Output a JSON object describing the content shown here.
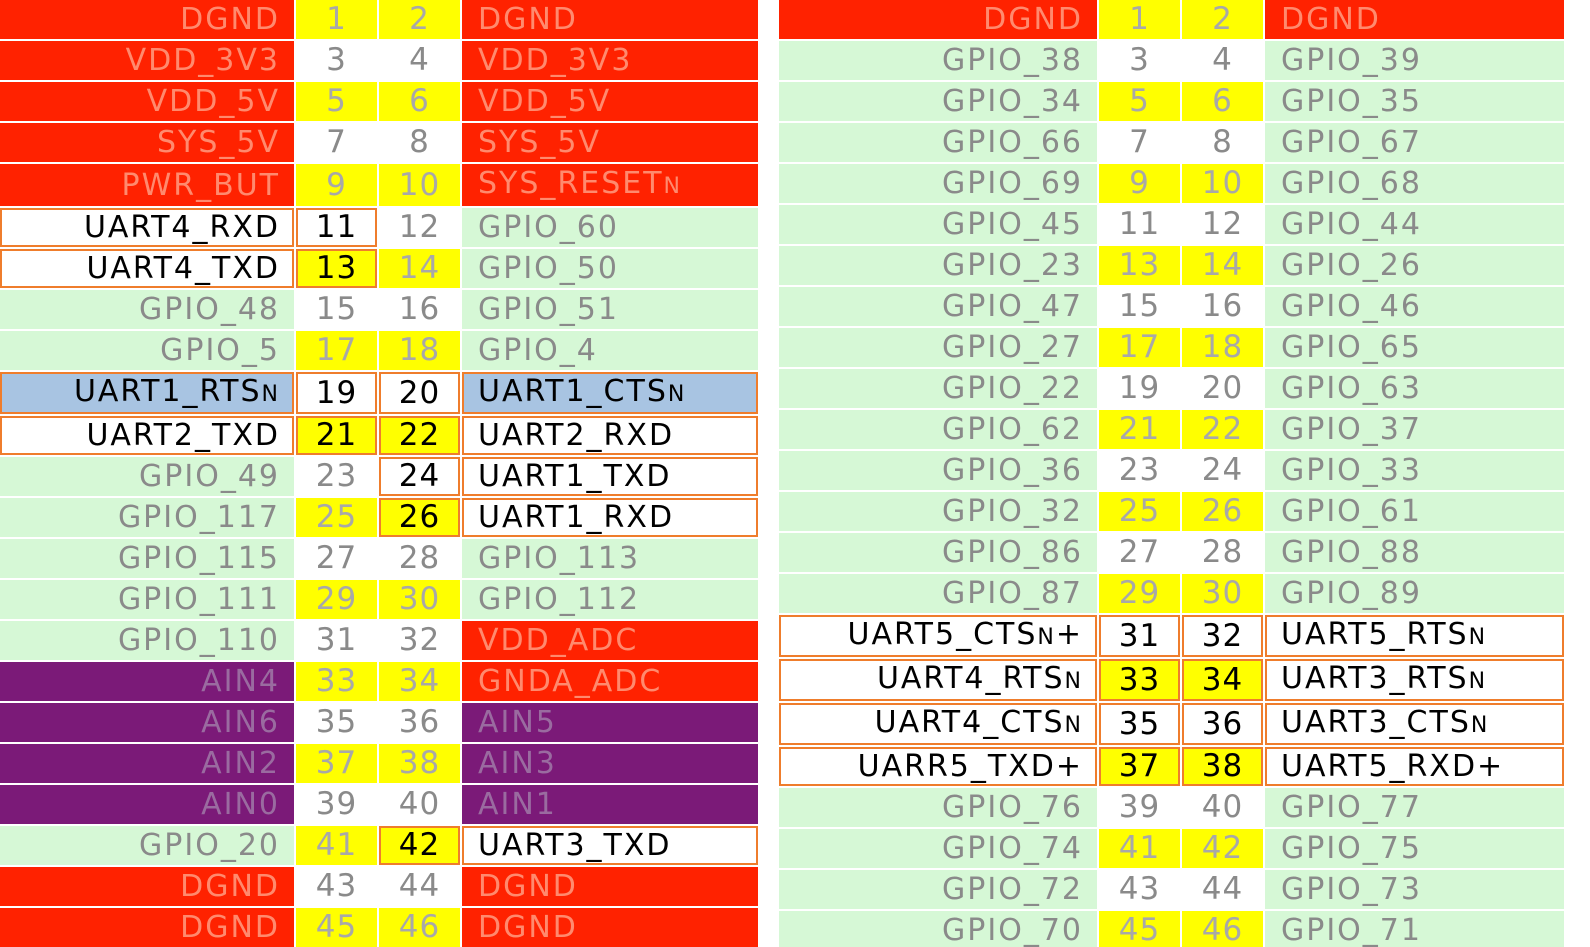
{
  "colors": {
    "power": "#ff2200",
    "gpio": "#d6f8d6",
    "analog": "#7b1a78",
    "uart_border": "#ef7d2c",
    "uart_highlight": "#a8c4e2",
    "pin_yellow": "#ffff00"
  },
  "headers": [
    {
      "id": "p8",
      "rows": [
        {
          "left": "DGND",
          "lpin": "1",
          "rpin": "2",
          "right": "DGND",
          "lt": "power",
          "rt": "power",
          "lpu": false,
          "rpu": false
        },
        {
          "left": "VDD_3V3",
          "lpin": "3",
          "rpin": "4",
          "right": "VDD_3V3",
          "lt": "power",
          "rt": "power",
          "lpu": false,
          "rpu": false
        },
        {
          "left": "VDD_5V",
          "lpin": "5",
          "rpin": "6",
          "right": "VDD_5V",
          "lt": "power",
          "rt": "power",
          "lpu": false,
          "rpu": false
        },
        {
          "left": "SYS_5V",
          "lpin": "7",
          "rpin": "8",
          "right": "SYS_5V",
          "lt": "power",
          "rt": "power",
          "lpu": false,
          "rpu": false
        },
        {
          "left": "PWR_BUT",
          "lpin": "9",
          "rpin": "10",
          "right": "SYS_RESETn",
          "lt": "power",
          "rt": "power",
          "lpu": false,
          "rpu": false
        },
        {
          "left": "UART4_RXD",
          "lpin": "11",
          "rpin": "12",
          "right": "GPIO_60",
          "lt": "uart",
          "rt": "gpio",
          "lpu": true,
          "rpu": false
        },
        {
          "left": "UART4_TXD",
          "lpin": "13",
          "rpin": "14",
          "right": "GPIO_50",
          "lt": "uart",
          "rt": "gpio",
          "lpu": true,
          "rpu": false
        },
        {
          "left": "GPIO_48",
          "lpin": "15",
          "rpin": "16",
          "right": "GPIO_51",
          "lt": "gpio",
          "rt": "gpio",
          "lpu": false,
          "rpu": false
        },
        {
          "left": "GPIO_5",
          "lpin": "17",
          "rpin": "18",
          "right": "GPIO_4",
          "lt": "gpio",
          "rt": "gpio",
          "lpu": false,
          "rpu": false
        },
        {
          "left": "UART1_RTSn",
          "lpin": "19",
          "rpin": "20",
          "right": "UART1_CTSn",
          "lt": "uart-hl",
          "rt": "uart-hl",
          "lpu": true,
          "rpu": true
        },
        {
          "left": "UART2_TXD",
          "lpin": "21",
          "rpin": "22",
          "right": "UART2_RXD",
          "lt": "uart",
          "rt": "uart",
          "lpu": true,
          "rpu": true
        },
        {
          "left": "GPIO_49",
          "lpin": "23",
          "rpin": "24",
          "right": "UART1_TXD",
          "lt": "gpio",
          "rt": "uart",
          "lpu": false,
          "rpu": true
        },
        {
          "left": "GPIO_117",
          "lpin": "25",
          "rpin": "26",
          "right": "UART1_RXD",
          "lt": "gpio",
          "rt": "uart",
          "lpu": false,
          "rpu": true
        },
        {
          "left": "GPIO_115",
          "lpin": "27",
          "rpin": "28",
          "right": "GPIO_113",
          "lt": "gpio",
          "rt": "gpio",
          "lpu": false,
          "rpu": false
        },
        {
          "left": "GPIO_111",
          "lpin": "29",
          "rpin": "30",
          "right": "GPIO_112",
          "lt": "gpio",
          "rt": "gpio",
          "lpu": false,
          "rpu": false
        },
        {
          "left": "GPIO_110",
          "lpin": "31",
          "rpin": "32",
          "right": "VDD_ADC",
          "lt": "gpio",
          "rt": "power",
          "lpu": false,
          "rpu": false
        },
        {
          "left": "AIN4",
          "lpin": "33",
          "rpin": "34",
          "right": "GNDA_ADC",
          "lt": "analog",
          "rt": "power",
          "lpu": false,
          "rpu": false
        },
        {
          "left": "AIN6",
          "lpin": "35",
          "rpin": "36",
          "right": "AIN5",
          "lt": "analog",
          "rt": "analog",
          "lpu": false,
          "rpu": false
        },
        {
          "left": "AIN2",
          "lpin": "37",
          "rpin": "38",
          "right": "AIN3",
          "lt": "analog",
          "rt": "analog",
          "lpu": false,
          "rpu": false
        },
        {
          "left": "AIN0",
          "lpin": "39",
          "rpin": "40",
          "right": "AIN1",
          "lt": "analog",
          "rt": "analog",
          "lpu": false,
          "rpu": false
        },
        {
          "left": "GPIO_20",
          "lpin": "41",
          "rpin": "42",
          "right": "UART3_TXD",
          "lt": "gpio",
          "rt": "uart",
          "lpu": false,
          "rpu": true
        },
        {
          "left": "DGND",
          "lpin": "43",
          "rpin": "44",
          "right": "DGND",
          "lt": "power",
          "rt": "power",
          "lpu": false,
          "rpu": false
        },
        {
          "left": "DGND",
          "lpin": "45",
          "rpin": "46",
          "right": "DGND",
          "lt": "power",
          "rt": "power",
          "lpu": false,
          "rpu": false
        }
      ]
    },
    {
      "id": "p9",
      "rows": [
        {
          "left": "DGND",
          "lpin": "1",
          "rpin": "2",
          "right": "DGND",
          "lt": "power",
          "rt": "power",
          "lpu": false,
          "rpu": false
        },
        {
          "left": "GPIO_38",
          "lpin": "3",
          "rpin": "4",
          "right": "GPIO_39",
          "lt": "gpio",
          "rt": "gpio",
          "lpu": false,
          "rpu": false
        },
        {
          "left": "GPIO_34",
          "lpin": "5",
          "rpin": "6",
          "right": "GPIO_35",
          "lt": "gpio",
          "rt": "gpio",
          "lpu": false,
          "rpu": false
        },
        {
          "left": "GPIO_66",
          "lpin": "7",
          "rpin": "8",
          "right": "GPIO_67",
          "lt": "gpio",
          "rt": "gpio",
          "lpu": false,
          "rpu": false
        },
        {
          "left": "GPIO_69",
          "lpin": "9",
          "rpin": "10",
          "right": "GPIO_68",
          "lt": "gpio",
          "rt": "gpio",
          "lpu": false,
          "rpu": false
        },
        {
          "left": "GPIO_45",
          "lpin": "11",
          "rpin": "12",
          "right": "GPIO_44",
          "lt": "gpio",
          "rt": "gpio",
          "lpu": false,
          "rpu": false
        },
        {
          "left": "GPIO_23",
          "lpin": "13",
          "rpin": "14",
          "right": "GPIO_26",
          "lt": "gpio",
          "rt": "gpio",
          "lpu": false,
          "rpu": false
        },
        {
          "left": "GPIO_47",
          "lpin": "15",
          "rpin": "16",
          "right": "GPIO_46",
          "lt": "gpio",
          "rt": "gpio",
          "lpu": false,
          "rpu": false
        },
        {
          "left": "GPIO_27",
          "lpin": "17",
          "rpin": "18",
          "right": "GPIO_65",
          "lt": "gpio",
          "rt": "gpio",
          "lpu": false,
          "rpu": false
        },
        {
          "left": "GPIO_22",
          "lpin": "19",
          "rpin": "20",
          "right": "GPIO_63",
          "lt": "gpio",
          "rt": "gpio",
          "lpu": false,
          "rpu": false
        },
        {
          "left": "GPIO_62",
          "lpin": "21",
          "rpin": "22",
          "right": "GPIO_37",
          "lt": "gpio",
          "rt": "gpio",
          "lpu": false,
          "rpu": false
        },
        {
          "left": "GPIO_36",
          "lpin": "23",
          "rpin": "24",
          "right": "GPIO_33",
          "lt": "gpio",
          "rt": "gpio",
          "lpu": false,
          "rpu": false
        },
        {
          "left": "GPIO_32",
          "lpin": "25",
          "rpin": "26",
          "right": "GPIO_61",
          "lt": "gpio",
          "rt": "gpio",
          "lpu": false,
          "rpu": false
        },
        {
          "left": "GPIO_86",
          "lpin": "27",
          "rpin": "28",
          "right": "GPIO_88",
          "lt": "gpio",
          "rt": "gpio",
          "lpu": false,
          "rpu": false
        },
        {
          "left": "GPIO_87",
          "lpin": "29",
          "rpin": "30",
          "right": "GPIO_89",
          "lt": "gpio",
          "rt": "gpio",
          "lpu": false,
          "rpu": false
        },
        {
          "left": "UART5_CTSn+",
          "lpin": "31",
          "rpin": "32",
          "right": "UART5_RTSn",
          "lt": "uart",
          "rt": "uart",
          "lpu": true,
          "rpu": true
        },
        {
          "left": "UART4_RTSn",
          "lpin": "33",
          "rpin": "34",
          "right": "UART3_RTSn",
          "lt": "uart",
          "rt": "uart",
          "lpu": true,
          "rpu": true
        },
        {
          "left": "UART4_CTSn",
          "lpin": "35",
          "rpin": "36",
          "right": "UART3_CTSn",
          "lt": "uart",
          "rt": "uart",
          "lpu": true,
          "rpu": true
        },
        {
          "left": "UARR5_TXD+",
          "lpin": "37",
          "rpin": "38",
          "right": "UART5_RXD+",
          "lt": "uart",
          "rt": "uart",
          "lpu": true,
          "rpu": true
        },
        {
          "left": "GPIO_76",
          "lpin": "39",
          "rpin": "40",
          "right": "GPIO_77",
          "lt": "gpio",
          "rt": "gpio",
          "lpu": false,
          "rpu": false
        },
        {
          "left": "GPIO_74",
          "lpin": "41",
          "rpin": "42",
          "right": "GPIO_75",
          "lt": "gpio",
          "rt": "gpio",
          "lpu": false,
          "rpu": false
        },
        {
          "left": "GPIO_72",
          "lpin": "43",
          "rpin": "44",
          "right": "GPIO_73",
          "lt": "gpio",
          "rt": "gpio",
          "lpu": false,
          "rpu": false
        },
        {
          "left": "GPIO_70",
          "lpin": "45",
          "rpin": "46",
          "right": "GPIO_71",
          "lt": "gpio",
          "rt": "gpio",
          "lpu": false,
          "rpu": false
        }
      ]
    }
  ]
}
